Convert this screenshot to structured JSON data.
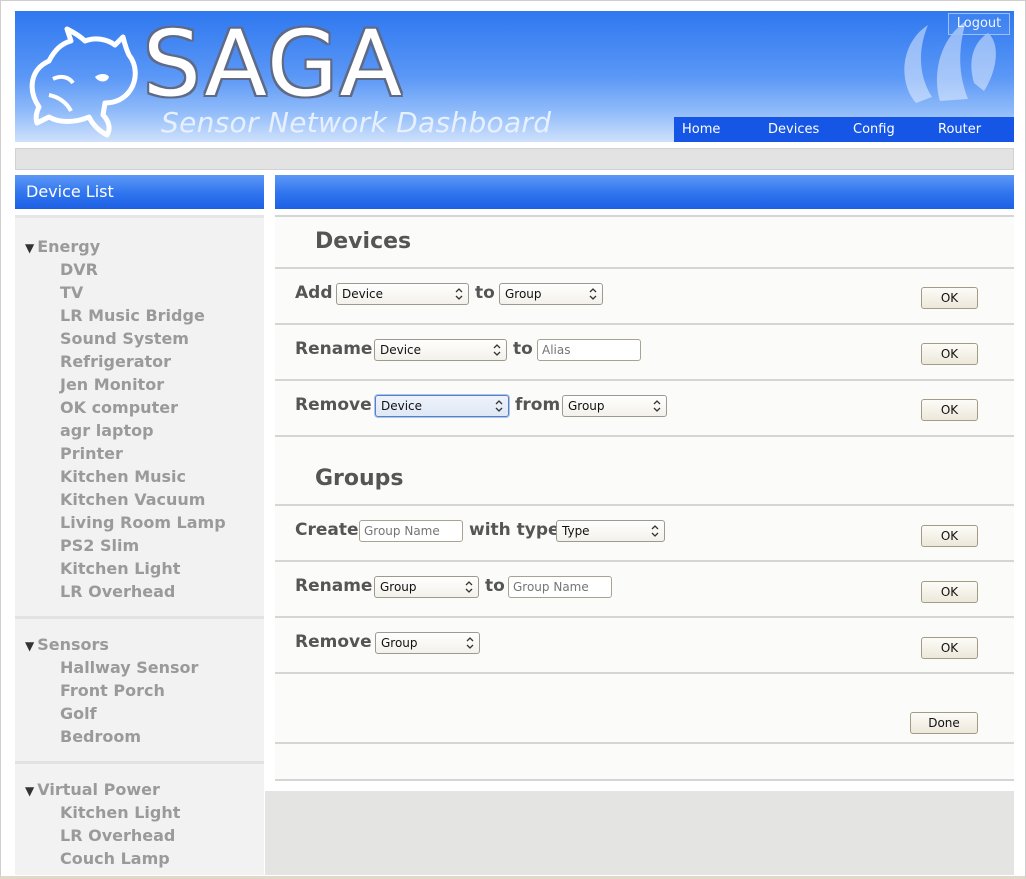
{
  "header": {
    "brand": "SAGA",
    "subtitle": "Sensor Network Dashboard",
    "logout_label": "Logout",
    "nav": [
      "Home",
      "Devices",
      "Config",
      "Router"
    ]
  },
  "sidebar": {
    "title": "Device List",
    "groups": [
      {
        "name": "Energy",
        "devices": [
          "DVR",
          "TV",
          "LR Music Bridge",
          "Sound System",
          "Refrigerator",
          "Jen Monitor",
          "OK computer",
          "agr laptop",
          "Printer",
          "Kitchen Music",
          "Kitchen Vacuum",
          "Living Room Lamp",
          "PS2 Slim",
          "Kitchen Light",
          "LR Overhead"
        ]
      },
      {
        "name": "Sensors",
        "devices": [
          "Hallway Sensor",
          "Front Porch",
          "Golf",
          "Bedroom"
        ]
      },
      {
        "name": "Virtual Power",
        "devices": [
          "Kitchen Light",
          "LR Overhead",
          "Couch Lamp"
        ]
      }
    ]
  },
  "devices_section": {
    "title": "Devices",
    "add": {
      "label": "Add",
      "device_select": "Device",
      "to": "to",
      "group_select": "Group",
      "ok": "OK"
    },
    "rename": {
      "label": "Rename",
      "device_select": "Device",
      "to": "to",
      "alias_placeholder": "Alias",
      "ok": "OK"
    },
    "remove": {
      "label": "Remove",
      "device_select": "Device",
      "from": "from",
      "group_select": "Group",
      "ok": "OK"
    }
  },
  "groups_section": {
    "title": "Groups",
    "create": {
      "label": "Create",
      "name_placeholder": "Group Name",
      "with_type": "with type",
      "type_select": "Type",
      "ok": "OK"
    },
    "rename": {
      "label": "Rename",
      "group_select": "Group",
      "to": "to",
      "name_placeholder": "Group Name",
      "ok": "OK"
    },
    "remove": {
      "label": "Remove",
      "group_select": "Group",
      "ok": "OK"
    }
  },
  "done_label": "Done",
  "colors": {
    "banner_blue": "#2f78f0",
    "nav_blue": "#1656e6",
    "label_gray": "#9a9a9a"
  },
  "icons": [
    "rhino-logo-icon",
    "watermark-logo-icon",
    "expand-triangle-icon",
    "select-arrows-icon"
  ]
}
